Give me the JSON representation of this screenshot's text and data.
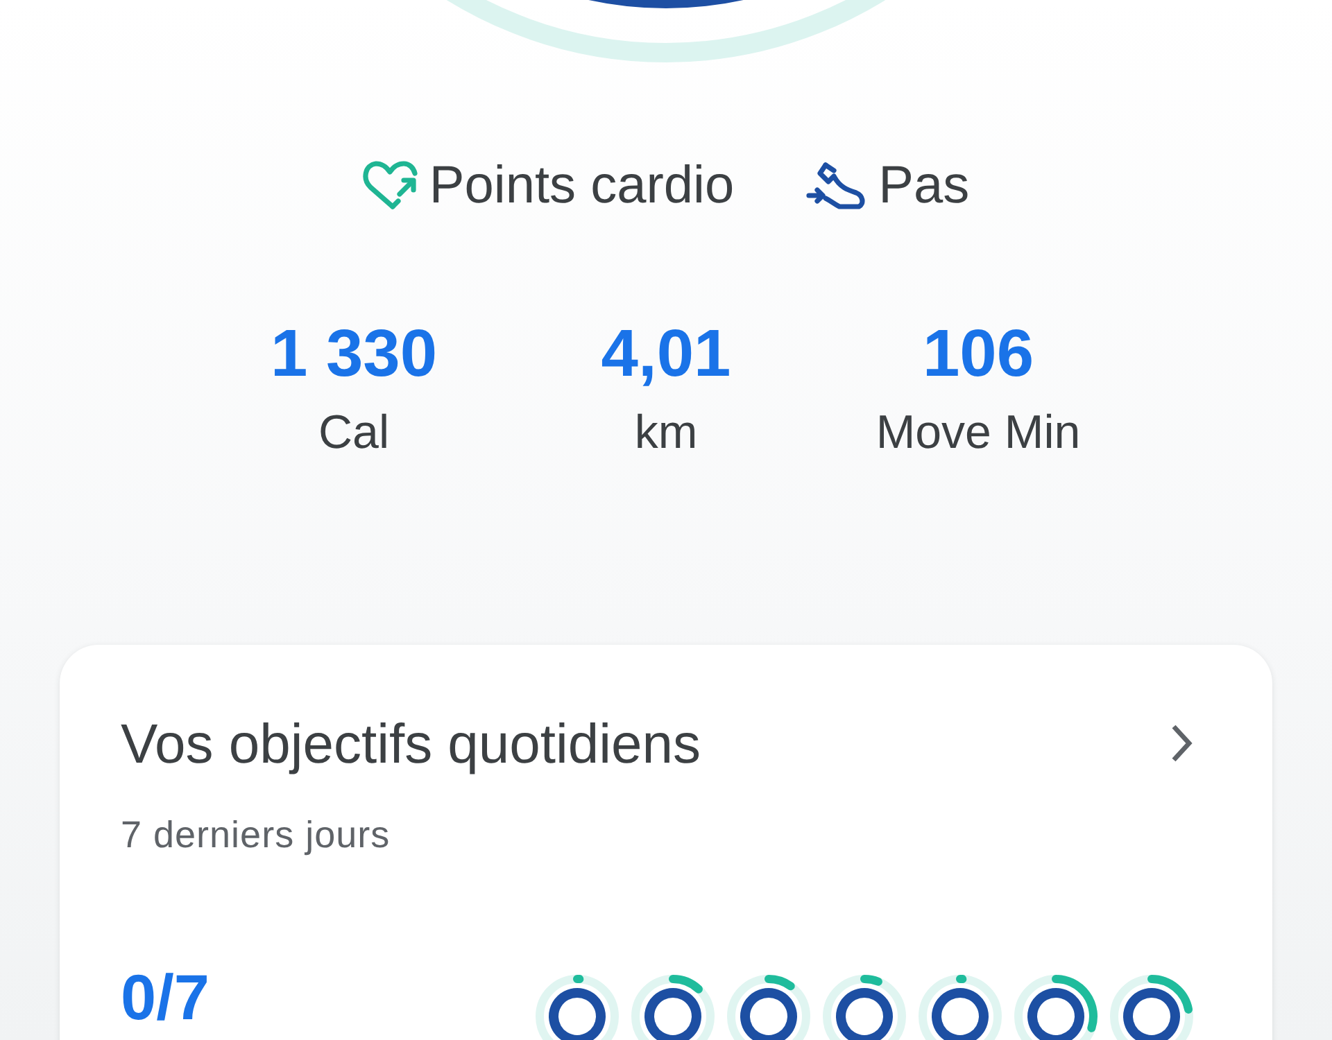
{
  "legend": [
    {
      "kind": "cardio",
      "label": "Points cardio"
    },
    {
      "kind": "steps",
      "label": "Pas"
    }
  ],
  "stats": [
    {
      "value": "1 330",
      "label": "Cal"
    },
    {
      "value": "4,01",
      "label": "km"
    },
    {
      "value": "106",
      "label": "Move Min"
    }
  ],
  "goals_card": {
    "title": "Vos objectifs quotidiens",
    "subtitle": "7 derniers jours",
    "count": "0/7"
  }
}
